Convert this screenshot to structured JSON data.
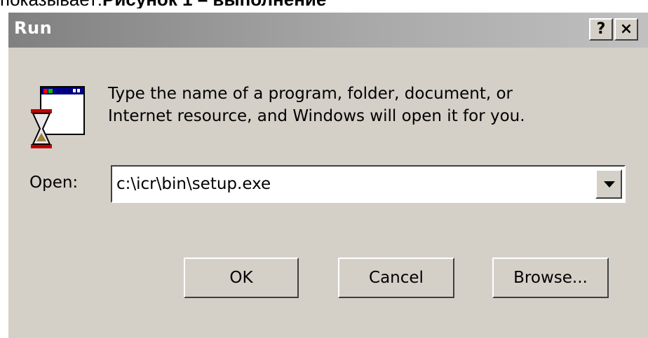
{
  "caption": {
    "lead": "показывает:",
    "bold": "Рисунок 1 – выполнение"
  },
  "window": {
    "title": "Run",
    "help_label": "?",
    "close_label": "×"
  },
  "dialog": {
    "prompt_line1": "Type the name of a program, folder, document, or",
    "prompt_line2": "Internet resource, and Windows will open it for you.",
    "open_label": "Open:",
    "open_value": "c:\\icr\\bin\\setup.exe",
    "ok_label": "OK",
    "cancel_label": "Cancel",
    "browse_label": "Browse..."
  },
  "icons": {
    "run": "run-program-icon",
    "dropdown": "chevron-down-icon"
  }
}
